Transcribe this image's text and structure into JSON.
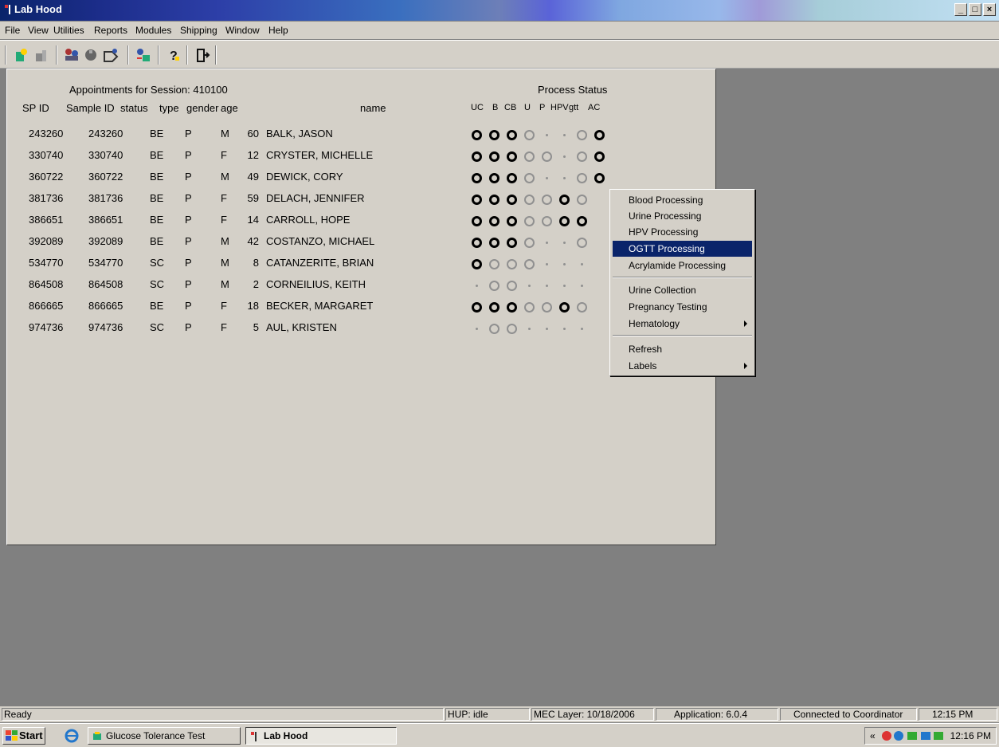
{
  "window": {
    "title": "Lab Hood",
    "min": "_",
    "max": "□",
    "close": "×"
  },
  "menu": [
    "File",
    "View",
    "Utilities",
    "Reports",
    "Modules",
    "Shipping",
    "Window",
    "Help"
  ],
  "panel": {
    "session_title": "Appointments for Session: 410100",
    "process_status_title": "Process Status",
    "headers": {
      "spid": "SP ID",
      "sampleid": "Sample ID",
      "status": "status",
      "type": "type",
      "gender": "gender",
      "age": "age",
      "name": "name"
    },
    "status_headers": [
      "UC",
      "B",
      "CB",
      "U",
      "P",
      "HPV",
      "gtt",
      "AC"
    ],
    "rows": [
      {
        "spid": "243260",
        "sampleid": "243260",
        "status": "BE",
        "type": "P",
        "gender": "M",
        "age": "60",
        "name": "BALK, JASON",
        "marks": [
          "b",
          "b",
          "b",
          "g",
          "d",
          "d",
          "g",
          "b"
        ]
      },
      {
        "spid": "330740",
        "sampleid": "330740",
        "status": "BE",
        "type": "P",
        "gender": "F",
        "age": "12",
        "name": "CRYSTER, MICHELLE",
        "marks": [
          "b",
          "b",
          "b",
          "g",
          "g",
          "d",
          "g",
          "b"
        ]
      },
      {
        "spid": "360722",
        "sampleid": "360722",
        "status": "BE",
        "type": "P",
        "gender": "M",
        "age": "49",
        "name": "DEWICK, CORY",
        "marks": [
          "b",
          "b",
          "b",
          "g",
          "d",
          "d",
          "g",
          "b"
        ]
      },
      {
        "spid": "381736",
        "sampleid": "381736",
        "status": "BE",
        "type": "P",
        "gender": "F",
        "age": "59",
        "name": "DELACH, JENNIFER",
        "marks": [
          "b",
          "b",
          "b",
          "g",
          "g",
          "b",
          "g",
          ""
        ]
      },
      {
        "spid": "386651",
        "sampleid": "386651",
        "status": "BE",
        "type": "P",
        "gender": "F",
        "age": "14",
        "name": "CARROLL, HOPE",
        "marks": [
          "b",
          "b",
          "b",
          "g",
          "g",
          "b",
          "b",
          ""
        ]
      },
      {
        "spid": "392089",
        "sampleid": "392089",
        "status": "BE",
        "type": "P",
        "gender": "M",
        "age": "42",
        "name": "COSTANZO, MICHAEL",
        "marks": [
          "b",
          "b",
          "b",
          "g",
          "d",
          "d",
          "g",
          ""
        ]
      },
      {
        "spid": "534770",
        "sampleid": "534770",
        "status": "SC",
        "type": "P",
        "gender": "M",
        "age": "8",
        "name": "CATANZERITE, BRIAN",
        "marks": [
          "b",
          "g",
          "g",
          "g",
          "d",
          "d",
          "d",
          ""
        ]
      },
      {
        "spid": "864508",
        "sampleid": "864508",
        "status": "SC",
        "type": "P",
        "gender": "M",
        "age": "2",
        "name": "CORNEILIUS, KEITH",
        "marks": [
          "d",
          "g",
          "g",
          "d",
          "d",
          "d",
          "d",
          ""
        ]
      },
      {
        "spid": "866665",
        "sampleid": "866665",
        "status": "BE",
        "type": "P",
        "gender": "F",
        "age": "18",
        "name": "BECKER, MARGARET",
        "marks": [
          "b",
          "b",
          "b",
          "g",
          "g",
          "b",
          "g",
          ""
        ]
      },
      {
        "spid": "974736",
        "sampleid": "974736",
        "status": "SC",
        "type": "P",
        "gender": "F",
        "age": "5",
        "name": "AUL, KRISTEN",
        "marks": [
          "d",
          "g",
          "g",
          "d",
          "d",
          "d",
          "d",
          ""
        ]
      }
    ]
  },
  "context_menu": {
    "items": [
      "Blood Processing",
      "Urine Processing",
      "HPV Processing",
      "OGTT Processing",
      "Acrylamide Processing",
      "Urine Collection",
      "Pregnancy Testing",
      "Hematology",
      "Refresh",
      "Labels"
    ],
    "selected": "OGTT Processing"
  },
  "status_bar": {
    "ready": "Ready",
    "hup": "HUP: idle",
    "mec": "MEC Layer: 10/18/2006",
    "app": "Application: 6.0.4",
    "conn": "Connected to Coordinator",
    "time": "12:15 PM"
  },
  "taskbar": {
    "start": "Start",
    "task1": "Glucose Tolerance Test",
    "task2": "Lab Hood",
    "tray_time": "12:16 PM",
    "tray_chevron": "«"
  },
  "colors": {
    "selection": "#0a246a",
    "face": "#d4d0c8",
    "desktop": "#808080"
  }
}
